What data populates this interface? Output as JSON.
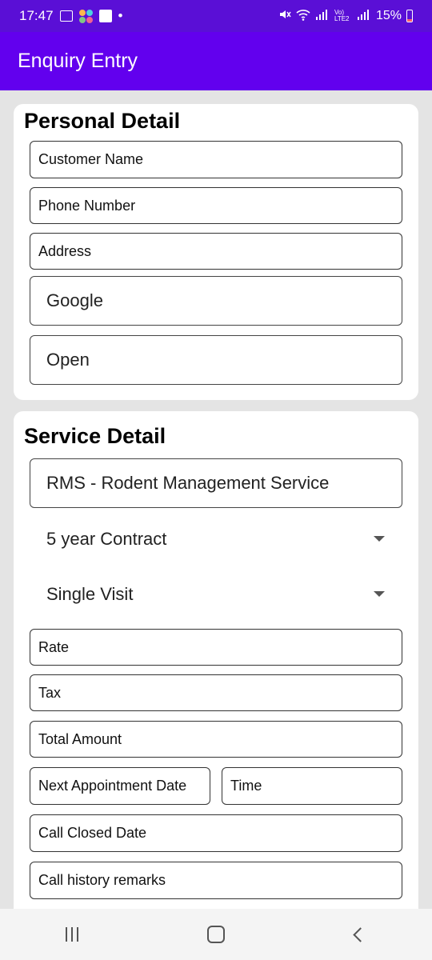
{
  "status_bar": {
    "time": "17:47",
    "battery_percent": "15%",
    "dot": "•",
    "network_label": "Vo) LTE2"
  },
  "app_bar": {
    "title": "Enquiry Entry"
  },
  "personal": {
    "title": "Personal Detail",
    "customer_name": "Customer Name",
    "phone_number": "Phone Number",
    "address": "Address",
    "source": "Google",
    "status": "Open"
  },
  "service": {
    "title": "Service Detail",
    "service_type": "RMS - Rodent Management Service",
    "contract": "5 year Contract",
    "visit": "Single Visit",
    "rate": "Rate",
    "tax": "Tax",
    "total_amount": "Total Amount",
    "next_appointment": "Next Appointment Date",
    "time": "Time",
    "call_closed_date": "Call Closed Date",
    "call_history": "Call history remarks"
  },
  "colors": {
    "status_bar": "#5a0fd6",
    "app_bar": "#6200ee",
    "background": "#e4e4e4"
  }
}
